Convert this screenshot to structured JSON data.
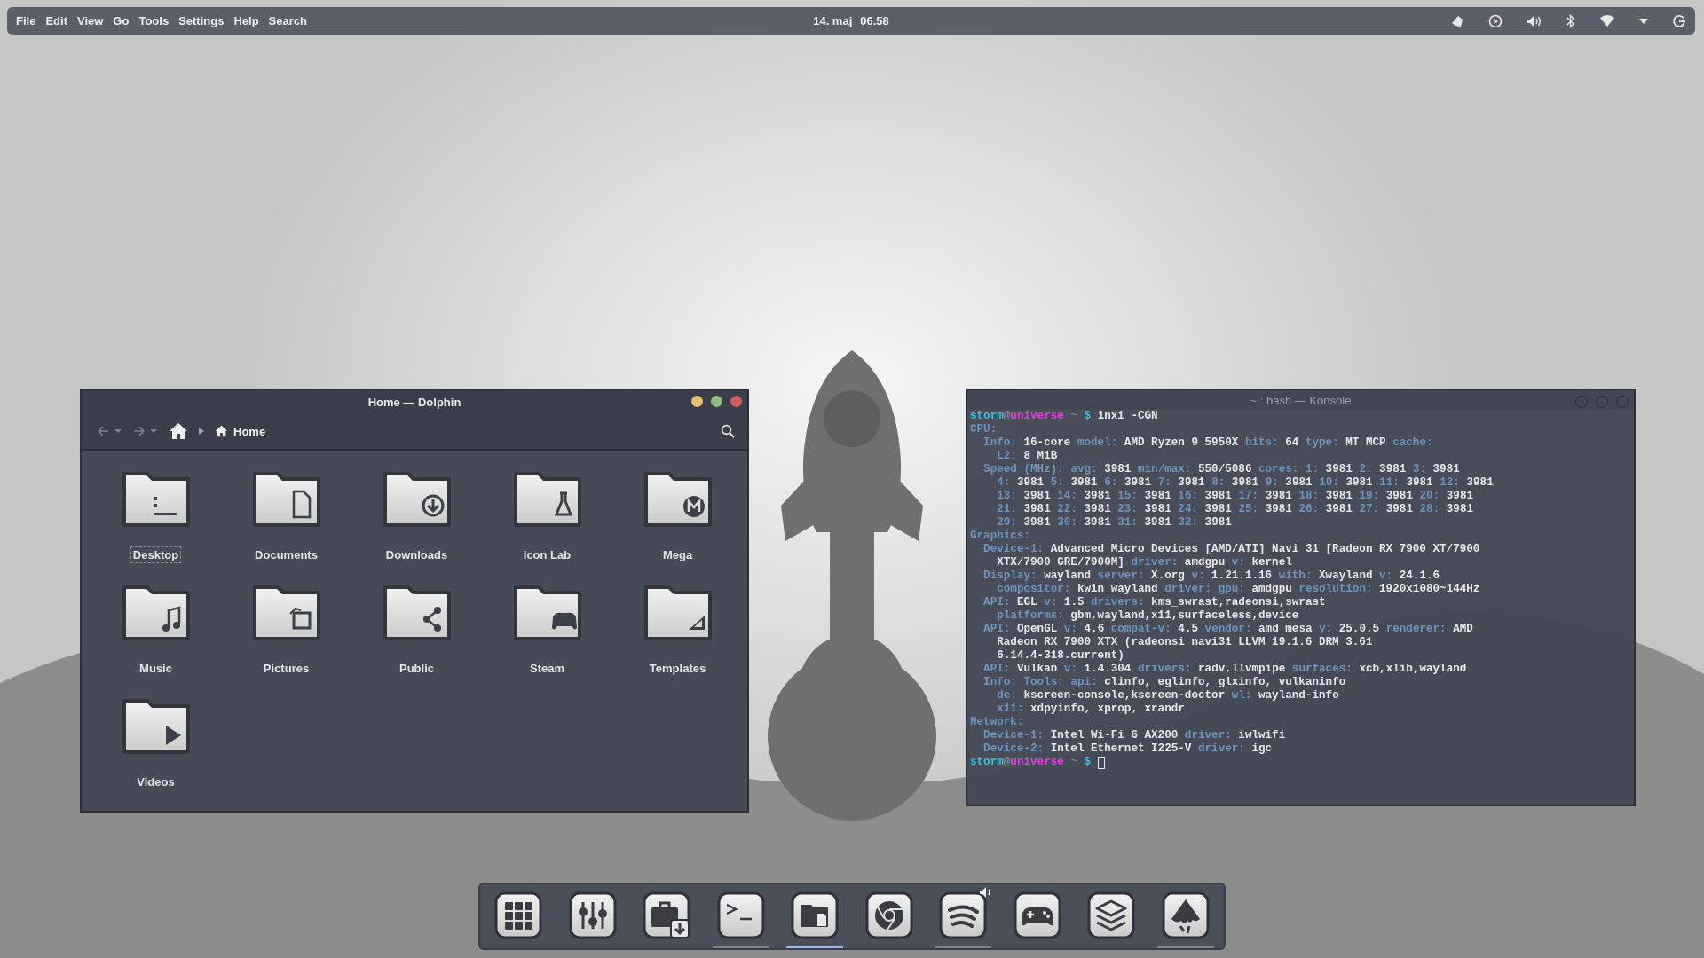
{
  "top_panel": {
    "menu": [
      "File",
      "Edit",
      "View",
      "Go",
      "Tools",
      "Settings",
      "Help",
      "Search"
    ],
    "date": "14. maj",
    "time": "06.58"
  },
  "dolphin": {
    "title": "Home — Dolphin",
    "breadcrumb": "Home",
    "folders": [
      {
        "name": "Desktop",
        "kind": "desktop",
        "focused": true
      },
      {
        "name": "Documents",
        "kind": "documents",
        "focused": false
      },
      {
        "name": "Downloads",
        "kind": "downloads",
        "focused": false
      },
      {
        "name": "Icon Lab",
        "kind": "lab",
        "focused": false
      },
      {
        "name": "Mega",
        "kind": "mega",
        "focused": false
      },
      {
        "name": "Music",
        "kind": "music",
        "focused": false
      },
      {
        "name": "Pictures",
        "kind": "pictures",
        "focused": false
      },
      {
        "name": "Public",
        "kind": "public",
        "focused": false
      },
      {
        "name": "Steam",
        "kind": "steam",
        "focused": false
      },
      {
        "name": "Templates",
        "kind": "templates",
        "focused": false
      },
      {
        "name": "Videos",
        "kind": "videos",
        "focused": false
      }
    ]
  },
  "konsole": {
    "title": "~ : bash — Konsole",
    "cursor_visible": true,
    "lines": [
      [
        {
          "kind": "user",
          "text": "storm"
        },
        {
          "kind": "at",
          "text": "@"
        },
        {
          "kind": "host",
          "text": "universe"
        },
        {
          "kind": "path",
          "text": " ~ "
        },
        {
          "kind": "prompt",
          "text": "$"
        },
        {
          "kind": "value",
          "text": " inxi -CGN"
        }
      ],
      [
        {
          "kind": "label",
          "text": "CPU:"
        }
      ],
      [
        {
          "kind": "label",
          "text": "  Info:"
        },
        {
          "kind": "value",
          "text": " 16-core "
        },
        {
          "kind": "label",
          "text": "model:"
        },
        {
          "kind": "value",
          "text": " AMD Ryzen 9 5950X "
        },
        {
          "kind": "label",
          "text": "bits:"
        },
        {
          "kind": "value",
          "text": " 64 "
        },
        {
          "kind": "label",
          "text": "type:"
        },
        {
          "kind": "value",
          "text": " MT MCP "
        },
        {
          "kind": "label",
          "text": "cache:"
        }
      ],
      [
        {
          "kind": "label",
          "text": "    L2:"
        },
        {
          "kind": "value",
          "text": " 8 MiB"
        }
      ],
      [
        {
          "kind": "label",
          "text": "  Speed (MHz): avg:"
        },
        {
          "kind": "value",
          "text": " 3981 "
        },
        {
          "kind": "label",
          "text": "min/max:"
        },
        {
          "kind": "value",
          "text": " 550/5086 "
        },
        {
          "kind": "label",
          "text": "cores: 1:"
        },
        {
          "kind": "value",
          "text": " 3981 "
        },
        {
          "kind": "label",
          "text": "2:"
        },
        {
          "kind": "value",
          "text": " 3981 "
        },
        {
          "kind": "label",
          "text": "3:"
        },
        {
          "kind": "value",
          "text": " 3981"
        }
      ],
      [
        {
          "kind": "label",
          "text": "    4:"
        },
        {
          "kind": "value",
          "text": " 3981 "
        },
        {
          "kind": "label",
          "text": "5:"
        },
        {
          "kind": "value",
          "text": " 3981 "
        },
        {
          "kind": "label",
          "text": "6:"
        },
        {
          "kind": "value",
          "text": " 3981 "
        },
        {
          "kind": "label",
          "text": "7:"
        },
        {
          "kind": "value",
          "text": " 3981 "
        },
        {
          "kind": "label",
          "text": "8:"
        },
        {
          "kind": "value",
          "text": " 3981 "
        },
        {
          "kind": "label",
          "text": "9:"
        },
        {
          "kind": "value",
          "text": " 3981 "
        },
        {
          "kind": "label",
          "text": "10:"
        },
        {
          "kind": "value",
          "text": " 3981 "
        },
        {
          "kind": "label",
          "text": "11:"
        },
        {
          "kind": "value",
          "text": " 3981 "
        },
        {
          "kind": "label",
          "text": "12:"
        },
        {
          "kind": "value",
          "text": " 3981"
        }
      ],
      [
        {
          "kind": "label",
          "text": "    13:"
        },
        {
          "kind": "value",
          "text": " 3981 "
        },
        {
          "kind": "label",
          "text": "14:"
        },
        {
          "kind": "value",
          "text": " 3981 "
        },
        {
          "kind": "label",
          "text": "15:"
        },
        {
          "kind": "value",
          "text": " 3981 "
        },
        {
          "kind": "label",
          "text": "16:"
        },
        {
          "kind": "value",
          "text": " 3981 "
        },
        {
          "kind": "label",
          "text": "17:"
        },
        {
          "kind": "value",
          "text": " 3981 "
        },
        {
          "kind": "label",
          "text": "18:"
        },
        {
          "kind": "value",
          "text": " 3981 "
        },
        {
          "kind": "label",
          "text": "19:"
        },
        {
          "kind": "value",
          "text": " 3981 "
        },
        {
          "kind": "label",
          "text": "20:"
        },
        {
          "kind": "value",
          "text": " 3981"
        }
      ],
      [
        {
          "kind": "label",
          "text": "    21:"
        },
        {
          "kind": "value",
          "text": " 3981 "
        },
        {
          "kind": "label",
          "text": "22:"
        },
        {
          "kind": "value",
          "text": " 3981 "
        },
        {
          "kind": "label",
          "text": "23:"
        },
        {
          "kind": "value",
          "text": " 3981 "
        },
        {
          "kind": "label",
          "text": "24:"
        },
        {
          "kind": "value",
          "text": " 3981 "
        },
        {
          "kind": "label",
          "text": "25:"
        },
        {
          "kind": "value",
          "text": " 3981 "
        },
        {
          "kind": "label",
          "text": "26:"
        },
        {
          "kind": "value",
          "text": " 3981 "
        },
        {
          "kind": "label",
          "text": "27:"
        },
        {
          "kind": "value",
          "text": " 3981 "
        },
        {
          "kind": "label",
          "text": "28:"
        },
        {
          "kind": "value",
          "text": " 3981"
        }
      ],
      [
        {
          "kind": "label",
          "text": "    29:"
        },
        {
          "kind": "value",
          "text": " 3981 "
        },
        {
          "kind": "label",
          "text": "30:"
        },
        {
          "kind": "value",
          "text": " 3981 "
        },
        {
          "kind": "label",
          "text": "31:"
        },
        {
          "kind": "value",
          "text": " 3981 "
        },
        {
          "kind": "label",
          "text": "32:"
        },
        {
          "kind": "value",
          "text": " 3981"
        }
      ],
      [
        {
          "kind": "label",
          "text": "Graphics:"
        }
      ],
      [
        {
          "kind": "label",
          "text": "  Device-1:"
        },
        {
          "kind": "value",
          "text": " Advanced Micro Devices [AMD/ATI] Navi 31 [Radeon RX 7900 XT/7900"
        }
      ],
      [
        {
          "kind": "value",
          "text": "    XTX/7900 GRE/7900M] "
        },
        {
          "kind": "label",
          "text": "driver:"
        },
        {
          "kind": "value",
          "text": " amdgpu "
        },
        {
          "kind": "label",
          "text": "v:"
        },
        {
          "kind": "value",
          "text": " kernel"
        }
      ],
      [
        {
          "kind": "label",
          "text": "  Display:"
        },
        {
          "kind": "value",
          "text": " wayland "
        },
        {
          "kind": "label",
          "text": "server:"
        },
        {
          "kind": "value",
          "text": " X.org "
        },
        {
          "kind": "label",
          "text": "v:"
        },
        {
          "kind": "value",
          "text": " 1.21.1.16 "
        },
        {
          "kind": "label",
          "text": "with:"
        },
        {
          "kind": "value",
          "text": " Xwayland "
        },
        {
          "kind": "label",
          "text": "v:"
        },
        {
          "kind": "value",
          "text": " 24.1.6"
        }
      ],
      [
        {
          "kind": "label",
          "text": "    compositor:"
        },
        {
          "kind": "value",
          "text": " kwin_wayland "
        },
        {
          "kind": "label",
          "text": "driver: gpu:"
        },
        {
          "kind": "value",
          "text": " amdgpu "
        },
        {
          "kind": "label",
          "text": "resolution:"
        },
        {
          "kind": "value",
          "text": " 1920x1080~144Hz"
        }
      ],
      [
        {
          "kind": "label",
          "text": "  API:"
        },
        {
          "kind": "value",
          "text": " EGL "
        },
        {
          "kind": "label",
          "text": "v:"
        },
        {
          "kind": "value",
          "text": " 1.5 "
        },
        {
          "kind": "label",
          "text": "drivers:"
        },
        {
          "kind": "value",
          "text": " kms_swrast,radeonsi,swrast"
        }
      ],
      [
        {
          "kind": "label",
          "text": "    platforms:"
        },
        {
          "kind": "value",
          "text": " gbm,wayland,x11,surfaceless,device"
        }
      ],
      [
        {
          "kind": "label",
          "text": "  API:"
        },
        {
          "kind": "value",
          "text": " OpenGL "
        },
        {
          "kind": "label",
          "text": "v:"
        },
        {
          "kind": "value",
          "text": " 4.6 "
        },
        {
          "kind": "label",
          "text": "compat-v:"
        },
        {
          "kind": "value",
          "text": " 4.5 "
        },
        {
          "kind": "label",
          "text": "vendor:"
        },
        {
          "kind": "value",
          "text": " amd mesa "
        },
        {
          "kind": "label",
          "text": "v:"
        },
        {
          "kind": "value",
          "text": " 25.0.5 "
        },
        {
          "kind": "label",
          "text": "renderer:"
        },
        {
          "kind": "value",
          "text": " AMD"
        }
      ],
      [
        {
          "kind": "value",
          "text": "    Radeon RX 7900 XTX (radeonsi navi31 LLVM 19.1.6 DRM 3.61"
        }
      ],
      [
        {
          "kind": "value",
          "text": "    6.14.4-318.current)"
        }
      ],
      [
        {
          "kind": "label",
          "text": "  API:"
        },
        {
          "kind": "value",
          "text": " Vulkan "
        },
        {
          "kind": "label",
          "text": "v:"
        },
        {
          "kind": "value",
          "text": " 1.4.304 "
        },
        {
          "kind": "label",
          "text": "drivers:"
        },
        {
          "kind": "value",
          "text": " radv,llvmpipe "
        },
        {
          "kind": "label",
          "text": "surfaces:"
        },
        {
          "kind": "value",
          "text": " xcb,xlib,wayland"
        }
      ],
      [
        {
          "kind": "label",
          "text": "  Info: Tools: api:"
        },
        {
          "kind": "value",
          "text": " clinfo, eglinfo, glxinfo, vulkaninfo"
        }
      ],
      [
        {
          "kind": "label",
          "text": "    de:"
        },
        {
          "kind": "value",
          "text": " kscreen-console,kscreen-doctor "
        },
        {
          "kind": "label",
          "text": "wl:"
        },
        {
          "kind": "value",
          "text": " wayland-info"
        }
      ],
      [
        {
          "kind": "label",
          "text": "    x11:"
        },
        {
          "kind": "value",
          "text": " xdpyinfo, xprop, xrandr"
        }
      ],
      [
        {
          "kind": "label",
          "text": "Network:"
        }
      ],
      [
        {
          "kind": "label",
          "text": "  Device-1:"
        },
        {
          "kind": "value",
          "text": " Intel Wi-Fi 6 AX200 "
        },
        {
          "kind": "label",
          "text": "driver:"
        },
        {
          "kind": "value",
          "text": " iwlwifi"
        }
      ],
      [
        {
          "kind": "label",
          "text": "  Device-2:"
        },
        {
          "kind": "value",
          "text": " Intel Ethernet I225-V "
        },
        {
          "kind": "label",
          "text": "driver:"
        },
        {
          "kind": "value",
          "text": " igc"
        }
      ],
      [
        {
          "kind": "user",
          "text": "storm"
        },
        {
          "kind": "at",
          "text": "@"
        },
        {
          "kind": "host",
          "text": "universe"
        },
        {
          "kind": "path",
          "text": " ~ "
        },
        {
          "kind": "prompt",
          "text": "$"
        }
      ]
    ]
  },
  "dock": [
    {
      "kind": "apps",
      "running": false,
      "selected": false
    },
    {
      "kind": "mixer",
      "running": false,
      "selected": false
    },
    {
      "kind": "install",
      "running": false,
      "selected": false
    },
    {
      "kind": "terminal",
      "running": true,
      "selected": false
    },
    {
      "kind": "files",
      "running": true,
      "selected": true
    },
    {
      "kind": "browser",
      "running": false,
      "selected": false
    },
    {
      "kind": "waves",
      "running": true,
      "selected": false,
      "audio": true
    },
    {
      "kind": "gamepad",
      "running": false,
      "selected": false
    },
    {
      "kind": "layers",
      "running": false,
      "selected": false
    },
    {
      "kind": "mountain",
      "running": true,
      "selected": false
    }
  ]
}
